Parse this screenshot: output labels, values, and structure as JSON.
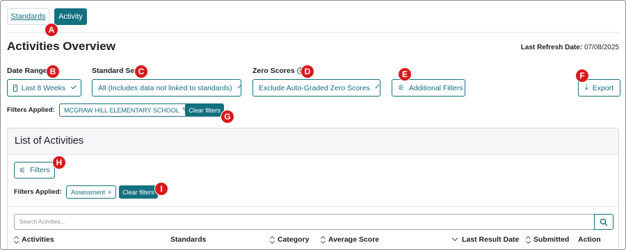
{
  "tabs": {
    "standards": "Standards",
    "activity": "Activity"
  },
  "page": {
    "title": "Activities Overview",
    "refresh_label": "Last Refresh Date:",
    "refresh_value": "07/08/2025"
  },
  "filters": {
    "date_range": {
      "label": "Date Range",
      "value": "Last 8 Weeks"
    },
    "standard_set": {
      "label": "Standard Set",
      "value": "All (Includes data not linked to standards)"
    },
    "zero_scores": {
      "label": "Zero Scores",
      "value": "Exclude Auto-Graded Zero Scores"
    },
    "additional": "Additional Filters",
    "export": "Export"
  },
  "applied_top": {
    "label": "Filters Applied:",
    "chip": "MCGRAW HILL ELEMENTARY SCHOOL",
    "clear": "Clear filters"
  },
  "list": {
    "title": "List of Activities",
    "filters_button": "Filters",
    "applied_label": "Filters Applied:",
    "chip": "Assessment",
    "clear": "Clear filters",
    "search_placeholder": "Search Activities...",
    "columns": {
      "activities": "Activities",
      "standards": "Standards",
      "category": "Category",
      "average_score": "Average Score",
      "last_result_date": "Last Result Date",
      "submitted": "Submitted",
      "action": "Action"
    }
  },
  "badges": [
    "A",
    "B",
    "C",
    "D",
    "E",
    "F",
    "G",
    "H",
    "I"
  ],
  "colors": {
    "accent": "#12707f",
    "badge": "#d9191d"
  }
}
